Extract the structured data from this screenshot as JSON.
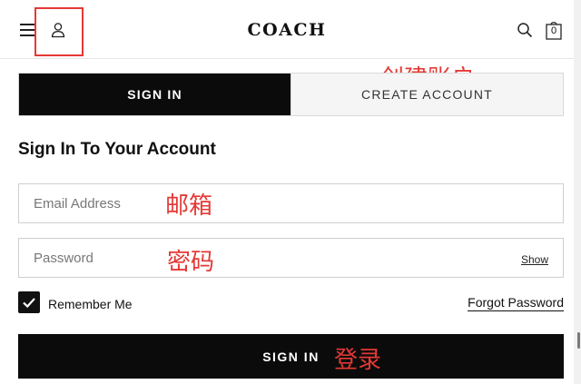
{
  "header": {
    "logo": "COACH",
    "bag_count": "0",
    "icons": [
      "menu-icon",
      "account-icon",
      "search-icon",
      "bag-icon"
    ]
  },
  "annotations": {
    "create_account": "创建账户",
    "email": "邮箱",
    "password": "密码",
    "login": "登录"
  },
  "tabs": [
    {
      "label": "SIGN IN",
      "active": true
    },
    {
      "label": "CREATE ACCOUNT",
      "active": false
    }
  ],
  "form": {
    "title": "Sign In To Your Account",
    "email_placeholder": "Email Address",
    "password_placeholder": "Password",
    "show_label": "Show",
    "remember_label": "Remember Me",
    "remember_checked": true,
    "forgot_label": "Forgot Password",
    "submit_label": "SIGN IN"
  },
  "colors": {
    "primary": "#0b0b0b",
    "annotation": "#e53935"
  }
}
